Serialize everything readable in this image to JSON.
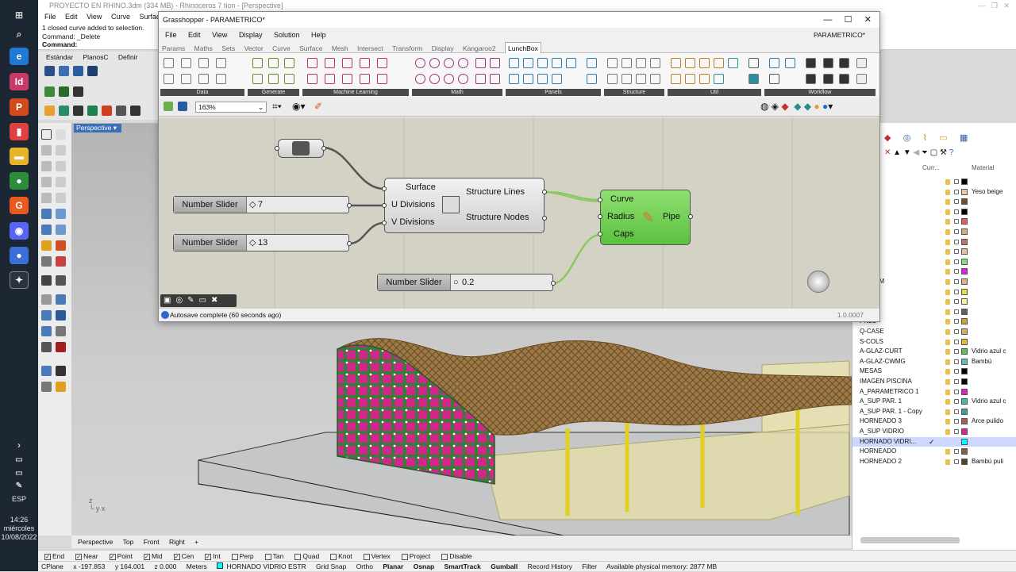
{
  "rhino": {
    "title": "PROYECTO EN RHINO.3dm (334 MB) - Rhinoceros 7 tion - [Perspective]",
    "menu": [
      "File",
      "Edit",
      "View",
      "Curve",
      "Surface"
    ],
    "command_history": [
      "1 closed curve added to selection.",
      "Command: _Delete",
      "Command:"
    ],
    "toolbar_tabs": [
      "Estándar",
      "PlanosC",
      "Definir vista"
    ],
    "viewport_label": "Perspective",
    "viewport_tabs": [
      "Perspective",
      "Top",
      "Front",
      "Right",
      "+"
    ],
    "osnaps": [
      {
        "label": "End",
        "checked": true
      },
      {
        "label": "Near",
        "checked": true
      },
      {
        "label": "Point",
        "checked": true
      },
      {
        "label": "Mid",
        "checked": true
      },
      {
        "label": "Cen",
        "checked": true
      },
      {
        "label": "Int",
        "checked": true
      },
      {
        "label": "Perp",
        "checked": false
      },
      {
        "label": "Tan",
        "checked": false
      },
      {
        "label": "Quad",
        "checked": false
      },
      {
        "label": "Knot",
        "checked": false
      },
      {
        "label": "Vertex",
        "checked": false
      },
      {
        "label": "Project",
        "checked": false
      },
      {
        "label": "Disable",
        "checked": false
      }
    ],
    "status": {
      "cplane": "CPlane",
      "x": "x -197.853",
      "y": "y 164.001",
      "z": "z 0.000",
      "units": "Meters",
      "layer": "HORNADO VIDRIO ESTR",
      "toggles": [
        "Grid Snap",
        "Ortho",
        "Planar",
        "Osnap",
        "SmartTrack",
        "Gumball",
        "Record History",
        "Filter"
      ],
      "memory": "Available physical memory: 2877 MB"
    }
  },
  "taskbar": {
    "lang": "ESP",
    "time": "14:26",
    "day": "miércoles",
    "date": "10/08/2022"
  },
  "grasshopper": {
    "title": "Grasshopper - PARAMETRICO*",
    "doc_name": "PARAMETRICO*",
    "menu": [
      "File",
      "Edit",
      "View",
      "Display",
      "Solution",
      "Help"
    ],
    "tabs": [
      "Params",
      "Maths",
      "Sets",
      "Vector",
      "Curve",
      "Surface",
      "Mesh",
      "Intersect",
      "Transform",
      "Display",
      "Kangaroo2",
      "LunchBox"
    ],
    "active_tab": "LunchBox",
    "ribbon_groups": [
      "Data",
      "Generate",
      "Machine Learning",
      "Math",
      "Panels",
      "Structure",
      "Util",
      "Workflow"
    ],
    "zoom": "163%",
    "status": "Autosave complete (60 seconds ago)",
    "version": "1.0.0007",
    "components": {
      "structure": {
        "inputs": [
          "Surface",
          "U Divisions",
          "V Divisions"
        ],
        "outputs": [
          "Structure Lines",
          "Structure Nodes"
        ]
      },
      "pipe": {
        "inputs": [
          "Curve",
          "Radius",
          "Caps"
        ],
        "name": "Pipe"
      }
    },
    "sliders": [
      {
        "label": "Number Slider",
        "value": "7"
      },
      {
        "label": "Number Slider",
        "value": "13"
      },
      {
        "label": "Number Slider",
        "value": "0.2"
      }
    ]
  },
  "layers": {
    "header": {
      "current": "Curr...",
      "material": "Material"
    },
    "rows": [
      {
        "name": "",
        "color": "#000000",
        "material": ""
      },
      {
        "name": "L",
        "color": "#e8c9a8",
        "material": "Yeso beige"
      },
      {
        "name": "",
        "color": "#7a4a2a",
        "material": ""
      },
      {
        "name": "",
        "color": "#000000",
        "material": ""
      },
      {
        "name": "-HRAL",
        "color": "#e06060",
        "material": ""
      },
      {
        "name": "R",
        "color": "#d0b080",
        "material": ""
      },
      {
        "name": "M",
        "color": "#c07070",
        "material": ""
      },
      {
        "name": "",
        "color": "#e0c0a0",
        "material": ""
      },
      {
        "name": "Q",
        "color": "#80e080",
        "material": ""
      },
      {
        "name": "R-FIXT",
        "color": "#e020e0",
        "material": ""
      },
      {
        "name": "R-FRAM",
        "color": "#e0b090",
        "material": ""
      },
      {
        "name": "",
        "color": "#e0e040",
        "material": ""
      },
      {
        "name": "-LEVL",
        "color": "#f0f0a0",
        "material": ""
      },
      {
        "name": "",
        "color": "#606060",
        "material": ""
      },
      {
        "name": "PNLS",
        "color": "#d0a030",
        "material": ""
      },
      {
        "name": "Q-CASE",
        "color": "#d0b060",
        "material": ""
      },
      {
        "name": "S-COLS",
        "color": "#e0c030",
        "material": ""
      },
      {
        "name": "A-GLAZ-CURT",
        "color": "#60c060",
        "material": "Vidrio azul c"
      },
      {
        "name": "A-GLAZ-CWMG",
        "color": "#60c0c0",
        "material": "Bambú"
      },
      {
        "name": "MESAS",
        "color": "#000000",
        "material": ""
      },
      {
        "name": "IMAGEN PISCINA",
        "color": "#000000",
        "material": ""
      },
      {
        "name": "A_PARAMETRICO 1",
        "color": "#e020c0",
        "material": ""
      },
      {
        "name": "A_SUP PAR. 1",
        "color": "#40c0a0",
        "material": "Vidrio azul c"
      },
      {
        "name": "A_SUP PAR. 1 - Copy",
        "color": "#40a0a0",
        "material": ""
      },
      {
        "name": "HORNEADO 3",
        "color": "#a06060",
        "material": "Arce pulido"
      },
      {
        "name": "A_SUP VIDRIO",
        "color": "#e020a0",
        "material": ""
      },
      {
        "name": "HORNADO VIDRI...",
        "color": "#00ffff",
        "material": "",
        "selected": true
      },
      {
        "name": "HORNEADO",
        "color": "#806040",
        "material": ""
      },
      {
        "name": "HORNEADO 2",
        "color": "#604020",
        "material": "Bambú puli"
      }
    ]
  }
}
